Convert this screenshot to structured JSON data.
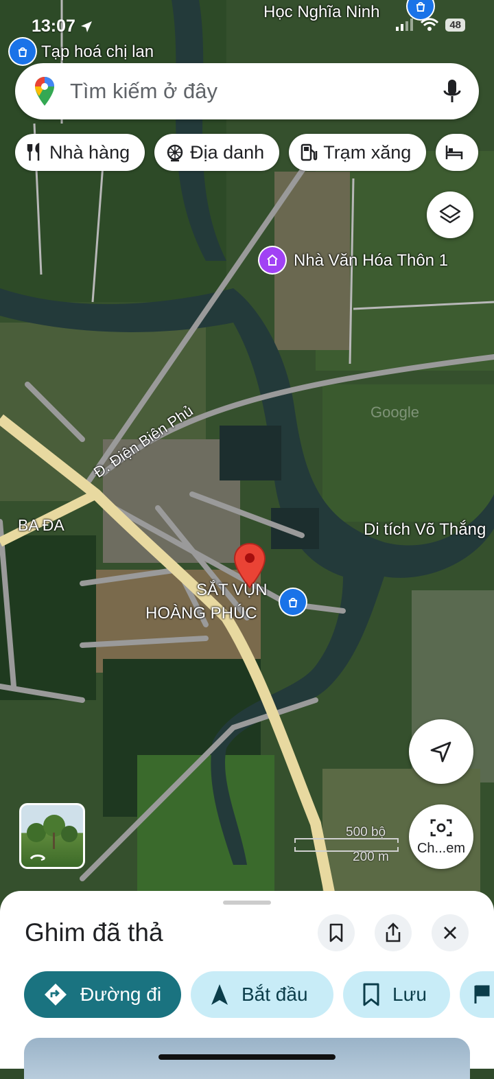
{
  "status": {
    "time": "13:07",
    "battery": "48"
  },
  "map": {
    "labels": {
      "hoc_nghia_ninh": "Học Nghĩa Ninh",
      "tap_hoa": "Tạp hoá chị lan",
      "nha_van_hoa": "Nhà Văn Hóa Thôn 1",
      "dien_bien_phu": "Đ. Điện Biên Phủ",
      "ba_da": "BA ĐA",
      "di_tich": "Di tích Võ Thắng",
      "sat_vun_line1": "SẮT VỤN",
      "sat_vun_line2": "HOÀNG PHÚC",
      "watermark": "Google"
    },
    "scale": {
      "imperial": "500 bộ",
      "metric": "200 m"
    },
    "colors": {
      "road_main": "#e8d9a0",
      "road_minor": "#9a9a9a",
      "water": "#233a3a",
      "pin": "#ea4335",
      "poi_shop": "#1a73e8",
      "poi_culture": "#a142f4"
    }
  },
  "search": {
    "placeholder": "Tìm kiếm ở đây",
    "left_icon": "google-maps-pin-icon",
    "right_icon": "microphone-icon"
  },
  "chips": [
    {
      "label": "Nhà hàng",
      "icon": "restaurant-icon"
    },
    {
      "label": "Địa danh",
      "icon": "landmark-icon"
    },
    {
      "label": "Trạm xăng",
      "icon": "gas-station-icon"
    }
  ],
  "controls": {
    "layers": "layers-icon",
    "my_location": "navigation-arrow-icon",
    "lens_label": "Ch...em"
  },
  "sheet": {
    "title": "Ghim đã thả",
    "actions": [
      {
        "label": "Đường đi",
        "icon": "directions-icon"
      },
      {
        "label": "Bắt đầu",
        "icon": "navigation-start-icon"
      },
      {
        "label": "Lưu",
        "icon": "bookmark-icon"
      }
    ]
  }
}
